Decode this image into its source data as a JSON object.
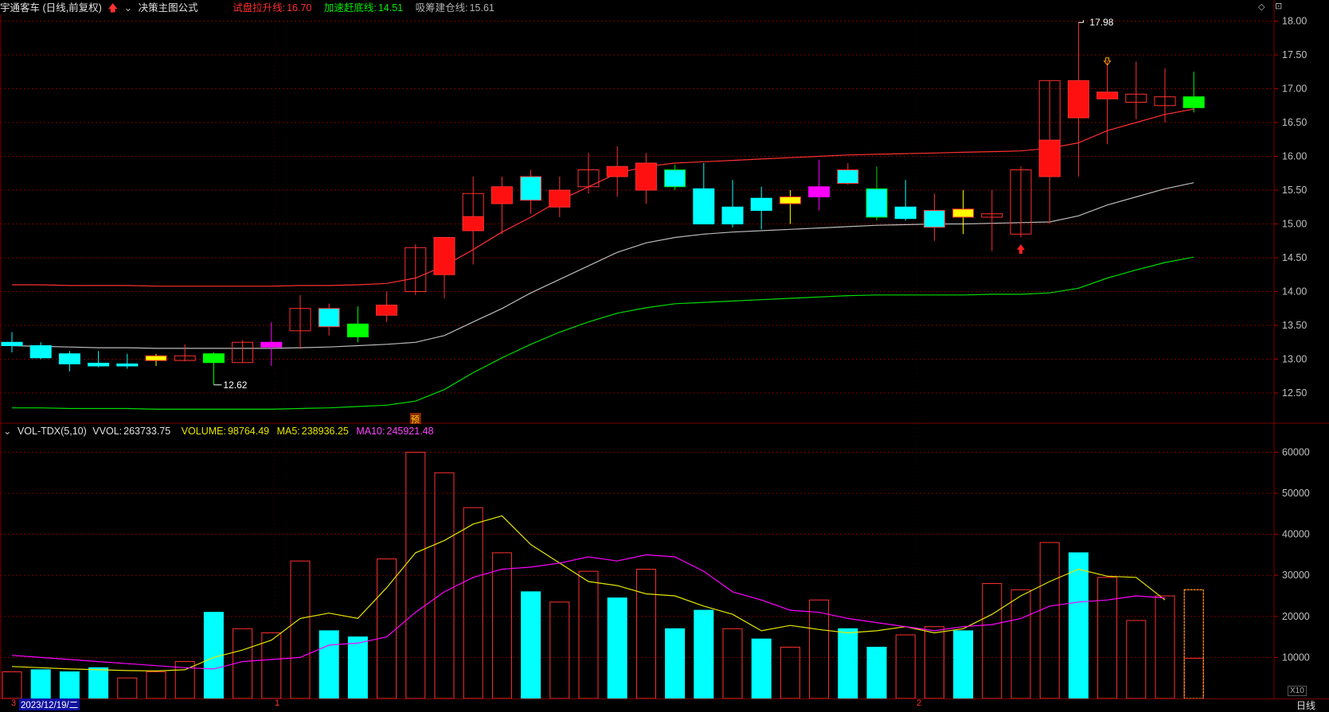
{
  "header": {
    "stock_title": "宇通客车 (日线,前复权)",
    "formula_name": "决策主图公式",
    "ind1_label": "试盘拉升线:",
    "ind1_value": "16.70",
    "ind2_label": "加速赶底线:",
    "ind2_value": "14.51",
    "ind3_label": "吸筹建仓线:",
    "ind3_value": "15.61"
  },
  "volume_header": {
    "name": "VOL-TDX(5,10)",
    "vvol_label": "VVOL:",
    "vvol_value": "263733.75",
    "volume_label": "VOLUME:",
    "volume_value": "98764.49",
    "ma5_label": "MA5:",
    "ma5_value": "238936.25",
    "ma10_label": "MA10:",
    "ma10_value": "245921.48"
  },
  "price_axis": [
    "18.00",
    "17.50",
    "17.00",
    "16.50",
    "16.00",
    "15.50",
    "15.00",
    "14.50",
    "14.00",
    "13.50",
    "13.00",
    "12.50"
  ],
  "volume_axis": [
    "60000",
    "50000",
    "40000",
    "30000",
    "20000",
    "10000"
  ],
  "x10_label": "X10",
  "annotations": {
    "high_label": "17.98",
    "low_label": "12.62",
    "pre_marker": "预"
  },
  "bottom_bar": {
    "start_marker": "3",
    "date_label": "2023/12/19/二",
    "month_1": "1",
    "month_2": "2",
    "period_label": "日线"
  },
  "colors": {
    "up": "#ff3030",
    "down": "#00ffff",
    "yellow_line": "#e6e600",
    "magenta": "#ff00ff",
    "green_line": "#00dd00",
    "grid": "#7a0000",
    "axis_text": "#c0c0c0"
  },
  "chart_data": [
    {
      "type": "candlestick",
      "price_range": [
        12.1,
        18.1
      ],
      "candles": [
        {
          "o": 13.25,
          "h": 13.4,
          "l": 13.1,
          "c": 13.2,
          "style": "down"
        },
        {
          "o": 13.2,
          "h": 13.25,
          "l": 13.0,
          "c": 13.02,
          "style": "down"
        },
        {
          "o": 13.08,
          "h": 13.12,
          "l": 12.82,
          "c": 12.93,
          "style": "down"
        },
        {
          "o": 12.94,
          "h": 13.12,
          "l": 12.88,
          "c": 12.9,
          "style": "down"
        },
        {
          "o": 12.93,
          "h": 13.08,
          "l": 12.86,
          "c": 12.9,
          "style": "down"
        },
        {
          "o": 12.98,
          "h": 13.08,
          "l": 12.9,
          "c": 13.05,
          "style": "doji_yellow"
        },
        {
          "o": 12.98,
          "h": 13.22,
          "l": 12.97,
          "c": 13.05,
          "style": "up_hollow"
        },
        {
          "o": 12.95,
          "h": 13.1,
          "l": 12.62,
          "c": 13.08,
          "style": "green"
        },
        {
          "o": 12.95,
          "h": 13.28,
          "l": 12.95,
          "c": 13.25,
          "style": "up_hollow"
        },
        {
          "o": 13.18,
          "h": 13.55,
          "l": 12.9,
          "c": 13.25,
          "style": "magenta"
        },
        {
          "o": 13.42,
          "h": 13.95,
          "l": 13.15,
          "c": 13.75,
          "style": "up_hollow"
        },
        {
          "o": 13.75,
          "h": 13.82,
          "l": 13.35,
          "c": 13.48,
          "style": "down_red"
        },
        {
          "o": 13.52,
          "h": 13.78,
          "l": 13.25,
          "c": 13.33,
          "style": "green"
        },
        {
          "o": 13.65,
          "h": 14.0,
          "l": 13.55,
          "c": 13.8,
          "style": "up_filled"
        },
        {
          "o": 14.0,
          "h": 14.7,
          "l": 13.95,
          "c": 14.65,
          "style": "up_hollow"
        },
        {
          "o": 14.8,
          "h": 14.8,
          "l": 13.9,
          "c": 14.25,
          "style": "up_filled"
        },
        {
          "o": 14.9,
          "h": 15.7,
          "l": 14.4,
          "c": 15.45,
          "style": "up_hollow_filled"
        },
        {
          "o": 15.55,
          "h": 15.7,
          "l": 14.85,
          "c": 15.3,
          "style": "up_filled"
        },
        {
          "o": 15.7,
          "h": 15.8,
          "l": 15.15,
          "c": 15.35,
          "style": "down_mixed"
        },
        {
          "o": 15.5,
          "h": 15.7,
          "l": 15.1,
          "c": 15.25,
          "style": "up_filled"
        },
        {
          "o": 15.55,
          "h": 16.05,
          "l": 15.45,
          "c": 15.8,
          "style": "up_hollow"
        },
        {
          "o": 15.85,
          "h": 16.15,
          "l": 15.4,
          "c": 15.7,
          "style": "up_filled"
        },
        {
          "o": 15.9,
          "h": 16.05,
          "l": 15.3,
          "c": 15.5,
          "style": "up_filled"
        },
        {
          "o": 15.8,
          "h": 15.88,
          "l": 15.5,
          "c": 15.55,
          "style": "down_green"
        },
        {
          "o": 15.52,
          "h": 15.9,
          "l": 15.0,
          "c": 15.0,
          "style": "down"
        },
        {
          "o": 15.25,
          "h": 15.65,
          "l": 14.95,
          "c": 15.0,
          "style": "down"
        },
        {
          "o": 15.38,
          "h": 15.55,
          "l": 14.92,
          "c": 15.2,
          "style": "down"
        },
        {
          "o": 15.3,
          "h": 15.5,
          "l": 15.0,
          "c": 15.4,
          "style": "doji_yellow"
        },
        {
          "o": 15.55,
          "h": 15.95,
          "l": 15.2,
          "c": 15.4,
          "style": "magenta"
        },
        {
          "o": 15.8,
          "h": 15.9,
          "l": 15.58,
          "c": 15.6,
          "style": "down_mixed"
        },
        {
          "o": 15.52,
          "h": 15.85,
          "l": 15.05,
          "c": 15.1,
          "style": "down_green"
        },
        {
          "o": 15.25,
          "h": 15.65,
          "l": 15.05,
          "c": 15.08,
          "style": "down"
        },
        {
          "o": 15.2,
          "h": 15.45,
          "l": 14.75,
          "c": 14.95,
          "style": "down_red"
        },
        {
          "o": 15.1,
          "h": 15.5,
          "l": 14.85,
          "c": 15.22,
          "style": "doji_yellow"
        },
        {
          "o": 15.1,
          "h": 15.5,
          "l": 14.6,
          "c": 15.15,
          "style": "up_hollow"
        },
        {
          "o": 14.85,
          "h": 15.85,
          "l": 14.8,
          "c": 15.8,
          "style": "up_hollow"
        },
        {
          "o": 15.7,
          "h": 17.12,
          "l": 15.0,
          "c": 17.12,
          "style": "up_hollow_filled"
        },
        {
          "o": 17.12,
          "h": 17.98,
          "l": 15.7,
          "c": 16.57,
          "style": "up_filled"
        },
        {
          "o": 16.95,
          "h": 17.42,
          "l": 16.18,
          "c": 16.85,
          "style": "up_filled"
        },
        {
          "o": 16.92,
          "h": 17.4,
          "l": 16.55,
          "c": 16.8,
          "style": "up_hollow"
        },
        {
          "o": 16.88,
          "h": 17.3,
          "l": 16.5,
          "c": 16.75,
          "style": "down_mixed_red"
        },
        {
          "o": 16.88,
          "h": 17.25,
          "l": 16.65,
          "c": 16.72,
          "style": "green"
        }
      ],
      "red_line": [
        14.1,
        14.1,
        14.09,
        14.09,
        14.09,
        14.08,
        14.08,
        14.08,
        14.08,
        14.08,
        14.09,
        14.09,
        14.1,
        14.12,
        14.2,
        14.38,
        14.62,
        14.88,
        15.1,
        15.35,
        15.55,
        15.75,
        15.85,
        15.9,
        15.92,
        15.94,
        15.96,
        15.98,
        16.0,
        16.02,
        16.03,
        16.04,
        16.05,
        16.06,
        16.07,
        16.08,
        16.12,
        16.2,
        16.38,
        16.5,
        16.62,
        16.7
      ],
      "white_line": [
        13.2,
        13.19,
        13.18,
        13.17,
        13.17,
        13.16,
        13.16,
        13.16,
        13.16,
        13.16,
        13.17,
        13.18,
        13.2,
        13.22,
        13.25,
        13.35,
        13.55,
        13.75,
        13.98,
        14.18,
        14.38,
        14.58,
        14.72,
        14.8,
        14.85,
        14.88,
        14.9,
        14.92,
        14.94,
        14.96,
        14.98,
        14.99,
        15.0,
        15.0,
        15.01,
        15.02,
        15.03,
        15.12,
        15.28,
        15.4,
        15.52,
        15.61
      ],
      "green_line": [
        12.28,
        12.28,
        12.27,
        12.27,
        12.27,
        12.26,
        12.26,
        12.26,
        12.26,
        12.26,
        12.27,
        12.28,
        12.3,
        12.32,
        12.38,
        12.55,
        12.8,
        13.02,
        13.22,
        13.4,
        13.55,
        13.68,
        13.76,
        13.82,
        13.84,
        13.86,
        13.88,
        13.9,
        13.92,
        13.94,
        13.95,
        13.95,
        13.95,
        13.95,
        13.96,
        13.96,
        13.98,
        14.05,
        14.2,
        14.32,
        14.43,
        14.51
      ]
    },
    {
      "type": "bar",
      "volume_range": [
        0,
        63000
      ],
      "volumes": [
        6500,
        7000,
        6500,
        7500,
        5000,
        6500,
        9000,
        21000,
        17000,
        16000,
        33500,
        16500,
        15000,
        34000,
        60000,
        55000,
        46500,
        35500,
        26000,
        23500,
        31000,
        24500,
        31500,
        17000,
        21500,
        17000,
        14500,
        12500,
        24000,
        17000,
        12500,
        15500,
        17500,
        16500,
        28000,
        26500,
        38000,
        35500,
        29500,
        19000,
        25000,
        26500
      ],
      "volume_current_partial": 9800,
      "volume_style": [
        "hollow",
        "filled",
        "filled",
        "filled",
        "hollow",
        "hollow",
        "hollow",
        "filled",
        "hollow",
        "hollow",
        "hollow",
        "filled",
        "filled",
        "hollow",
        "hollow",
        "hollow",
        "hollow",
        "hollow",
        "filled",
        "hollow",
        "hollow",
        "filled",
        "hollow",
        "filled",
        "filled",
        "hollow",
        "filled",
        "hollow",
        "hollow",
        "filled",
        "filled",
        "hollow",
        "hollow",
        "filled",
        "hollow",
        "hollow",
        "hollow",
        "filled",
        "hollow",
        "hollow",
        "hollow",
        "hollow"
      ],
      "ma5": [
        7800,
        7500,
        7200,
        7000,
        6800,
        6700,
        7000,
        10000,
        11800,
        14200,
        19500,
        20800,
        19500,
        27000,
        35500,
        38500,
        42500,
        44500,
        37500,
        33000,
        28500,
        27500,
        25500,
        25000,
        22500,
        20500,
        16500,
        17800,
        16800,
        16000,
        16500,
        17500,
        16000,
        17000,
        20500,
        25000,
        28500,
        31500,
        29800,
        29500,
        24000
      ],
      "ma10": [
        10500,
        10000,
        9500,
        9000,
        8500,
        8000,
        7500,
        7200,
        9000,
        9500,
        10000,
        13000,
        13500,
        15000,
        21000,
        26000,
        29500,
        31500,
        32000,
        33000,
        34500,
        33500,
        35000,
        34500,
        31000,
        26000,
        24000,
        21500,
        21000,
        19500,
        18500,
        17500,
        16500,
        17500,
        18000,
        19500,
        22500,
        23500,
        24000,
        25000,
        24500
      ]
    }
  ]
}
